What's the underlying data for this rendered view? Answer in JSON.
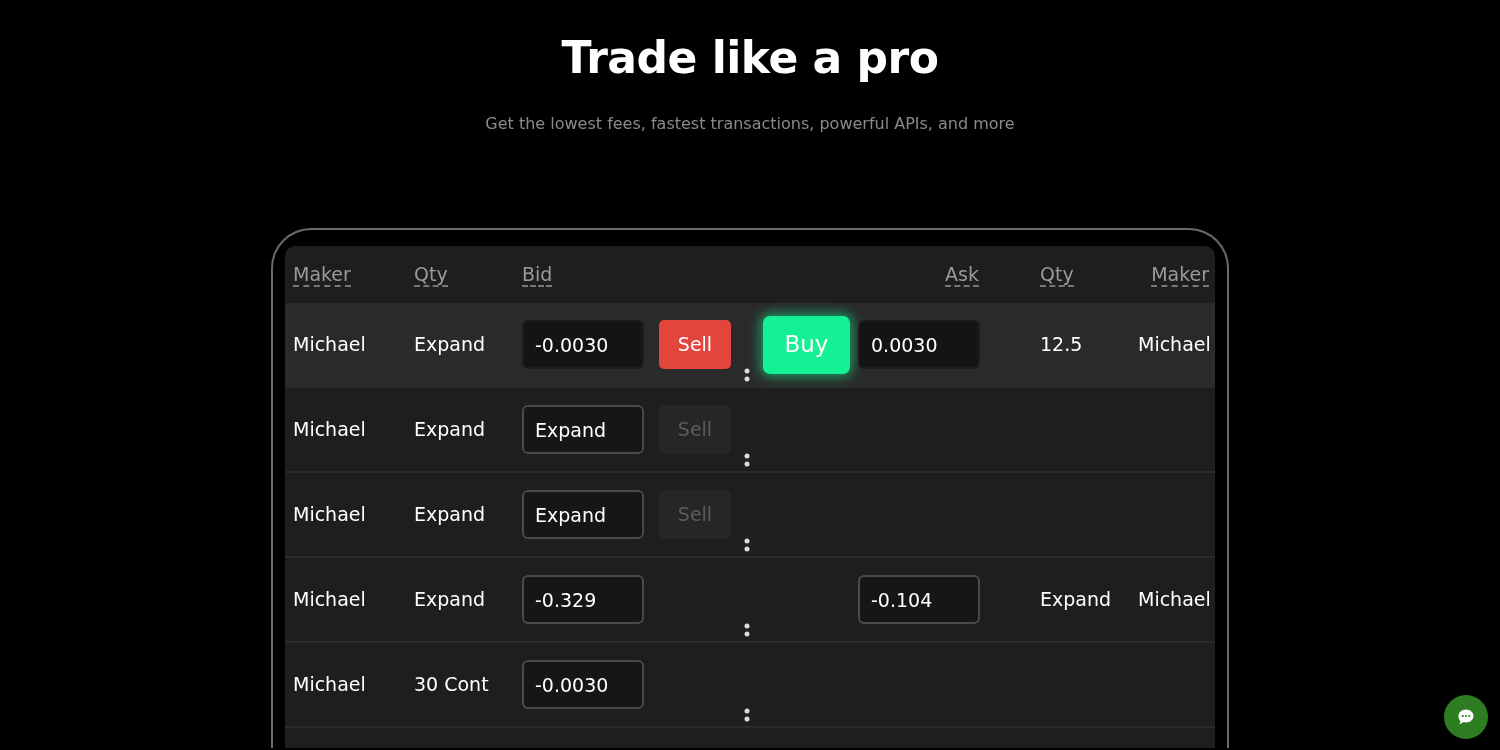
{
  "heading": "Trade like a pro",
  "subheading": "Get the lowest fees, fastest transactions, powerful APIs, and more",
  "columns": [
    {
      "label": "Maker"
    },
    {
      "label": "Qty"
    },
    {
      "label": "Bid"
    },
    {
      "label": "Ask"
    },
    {
      "label": "Qty"
    },
    {
      "label": "Maker"
    }
  ],
  "rows": [
    {
      "selected": true,
      "maker": "Michael",
      "qty": "Expand",
      "bid": "-0.0030",
      "sell": {
        "label": "Sell",
        "disabled": false
      },
      "buy": {
        "label": "Buy"
      },
      "ask": "0.0030",
      "ask_qty": "12.5",
      "ask_maker": "Michael"
    },
    {
      "selected": false,
      "maker": "Michael",
      "qty": "Expand",
      "bid": "Expand",
      "sell": {
        "label": "Sell",
        "disabled": true
      }
    },
    {
      "selected": false,
      "maker": "Michael",
      "qty": "Expand",
      "bid": "Expand",
      "sell": {
        "label": "Sell",
        "disabled": true
      }
    },
    {
      "selected": false,
      "maker": "Michael",
      "qty": "Expand",
      "bid": "-0.329",
      "ask": "-0.104",
      "ask_qty": "Expand",
      "ask_maker": "Michael"
    },
    {
      "selected": false,
      "maker": "Michael",
      "qty": "30 Cont",
      "bid": "-0.0030"
    }
  ]
}
